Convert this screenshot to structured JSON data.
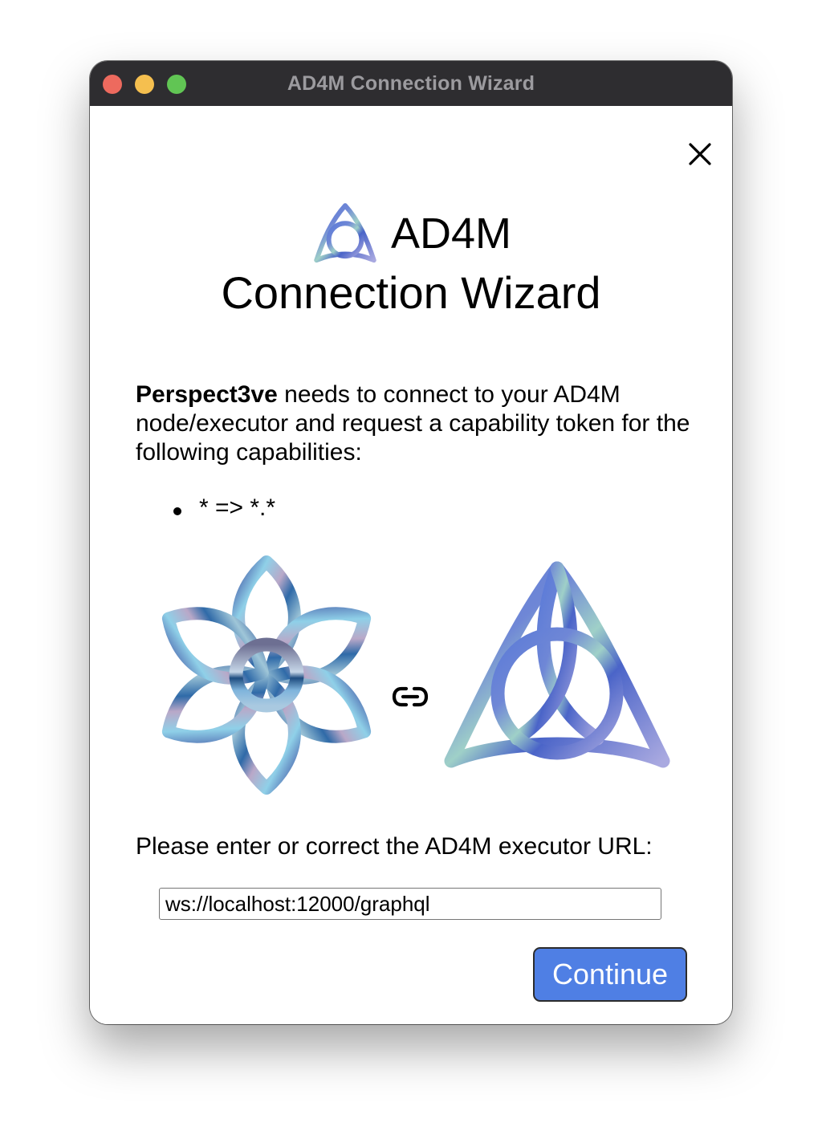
{
  "window": {
    "title": "AD4M Connection Wizard"
  },
  "header": {
    "line1": "AD4M",
    "line2": "Connection Wizard"
  },
  "description": {
    "app_name": "Perspect3ve",
    "text": " needs to connect to your AD4M node/executor and request a capability token for the following capabilities:"
  },
  "capabilities": [
    "* => *.*"
  ],
  "url_prompt": "Please enter or correct the AD4M executor URL:",
  "url_input": {
    "value": "ws://localhost:12000/graphql"
  },
  "continue_label": "Continue",
  "icons": {
    "close": "close-icon",
    "header_logo": "ad4m-logo-icon",
    "app_logo": "perspect3ve-logo-icon",
    "link": "link-icon",
    "executor_logo": "ad4m-logo-icon"
  },
  "colors": {
    "titlebar": "#2e2d30",
    "accent": "#4f7fe4",
    "traffic_red": "#ed6a5e",
    "traffic_yellow": "#f5bf4f",
    "traffic_green": "#61c554"
  }
}
